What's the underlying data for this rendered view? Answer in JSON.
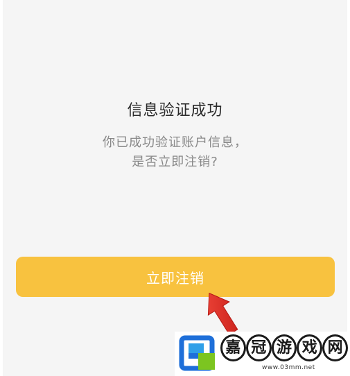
{
  "dialog": {
    "title": "信息验证成功",
    "message_line1": "你已成功验证账户信息，",
    "message_line2": "是否立即注销?",
    "confirm_label": "立即注销"
  },
  "pointer": {
    "icon": "arrow-pointer-icon",
    "color": "#e8332a"
  },
  "watermark": {
    "chars": [
      "嘉",
      "冠",
      "游",
      "戏",
      "网"
    ],
    "url": "www.03mm.net",
    "logo_icon": "site-logo-icon"
  },
  "colors": {
    "background": "#f5f5f5",
    "button": "#f8c23f",
    "title": "#2a2a2a",
    "message": "#888888"
  }
}
